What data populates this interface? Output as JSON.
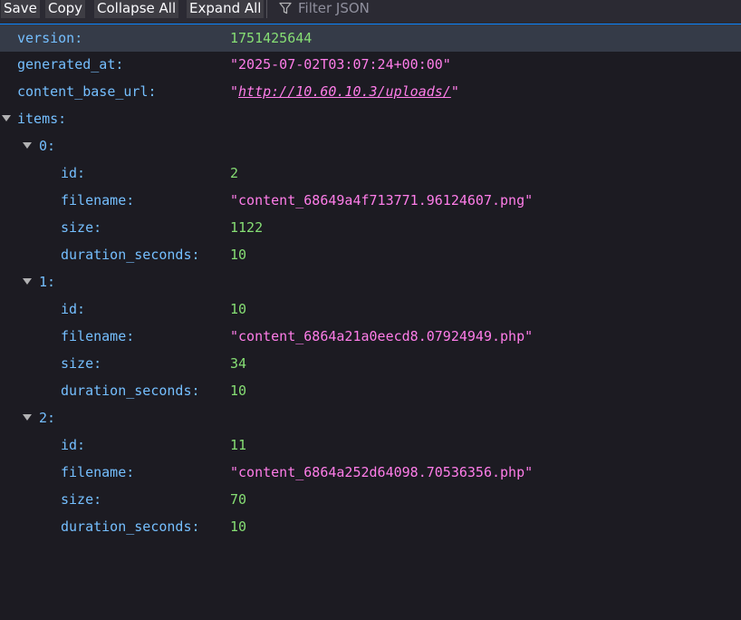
{
  "toolbar": {
    "save_label": "Save",
    "copy_label": "Copy",
    "collapse_all_label": "Collapse All",
    "expand_all_label": "Expand All",
    "filter_placeholder": "Filter JSON",
    "filter_icon": "filter-funnel-icon"
  },
  "colors": {
    "key": "#75bfff",
    "number": "#86de74",
    "string": "#ff7de9",
    "accent": "#0a84ff",
    "background": "#1c1b22"
  },
  "json": {
    "version": {
      "key": "version:",
      "value": "1751425644"
    },
    "generated_at": {
      "key": "generated_at:",
      "value": "\"2025-07-02T03:07:24+00:00\""
    },
    "content_base_url": {
      "key": "content_base_url:",
      "quote_open": "\"",
      "url": "http://10.60.10.3/uploads/",
      "quote_close": "\""
    },
    "items_key": "items:",
    "items": [
      {
        "index": "0:",
        "id": {
          "key": "id:",
          "value": "2"
        },
        "filename": {
          "key": "filename:",
          "value": "\"content_68649a4f713771.96124607.png\""
        },
        "size": {
          "key": "size:",
          "value": "1122"
        },
        "duration_seconds": {
          "key": "duration_seconds:",
          "value": "10"
        }
      },
      {
        "index": "1:",
        "id": {
          "key": "id:",
          "value": "10"
        },
        "filename": {
          "key": "filename:",
          "value": "\"content_6864a21a0eecd8.07924949.php\""
        },
        "size": {
          "key": "size:",
          "value": "34"
        },
        "duration_seconds": {
          "key": "duration_seconds:",
          "value": "10"
        }
      },
      {
        "index": "2:",
        "id": {
          "key": "id:",
          "value": "11"
        },
        "filename": {
          "key": "filename:",
          "value": "\"content_6864a252d64098.70536356.php\""
        },
        "size": {
          "key": "size:",
          "value": "70"
        },
        "duration_seconds": {
          "key": "duration_seconds:",
          "value": "10"
        }
      }
    ]
  }
}
